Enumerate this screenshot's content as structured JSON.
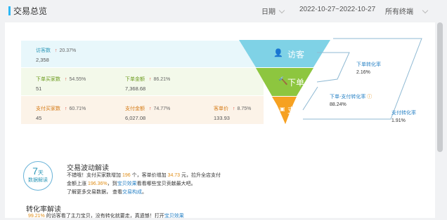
{
  "header": {
    "title": "交易总览",
    "date_label": "日期",
    "date_range": "2022-10-27~2022-10-27",
    "terminal": "所有终端"
  },
  "funnel": {
    "rows": [
      {
        "metrics": [
          {
            "label": "访客数",
            "pct": "20.37%",
            "value": "2,358"
          }
        ]
      },
      {
        "metrics": [
          {
            "label": "下单买家数",
            "pct": "54.55%",
            "value": "51"
          },
          {
            "label": "下单金额",
            "pct": "86.21%",
            "value": "7,368.68"
          }
        ]
      },
      {
        "metrics": [
          {
            "label": "支付买家数",
            "pct": "60.71%",
            "value": "45"
          },
          {
            "label": "支付金额",
            "pct": "74.77%",
            "value": "6,027.08"
          },
          {
            "label": "客单价",
            "pct": "8.75%",
            "value": "133.93"
          }
        ]
      }
    ],
    "stages": [
      "访客",
      "下单",
      "支付"
    ],
    "conversions": [
      {
        "label": "下单转化率",
        "value": "2.16%"
      },
      {
        "label": "下单-支付转化率",
        "value": "88.24%"
      },
      {
        "label": "支付转化率",
        "value": "1.91%"
      }
    ],
    "colors": {
      "visit": "#7fd2e6",
      "order": "#8dc63f",
      "pay": "#f6a121"
    }
  },
  "analysis": {
    "days_num": "7",
    "days_unit": "天",
    "badge_text": "数据解读",
    "wave_title": "交易波动解读",
    "line1": {
      "a": "不错哦！支付买家数增加",
      "n1": "196",
      "b": "个，客单价增加",
      "n2": "34.73",
      "c": "元，拉升全店支付"
    },
    "line2": {
      "a": "金额上涨",
      "n1": "196.36%",
      "b": "，到",
      "link": "宝贝效果",
      "c": "看看哪些宝贝贡献最大吧。"
    },
    "line3": {
      "a": "了解更多交易数据，",
      "b": "查看",
      "link": "交易构成",
      "c": "。"
    },
    "conv_title": "转化率解读",
    "conv_line": {
      "n": "99.21%",
      "a": "的访客看了主力宝贝，没有转化就要走，真遗憾！打开",
      "link": "宝贝效果"
    }
  }
}
